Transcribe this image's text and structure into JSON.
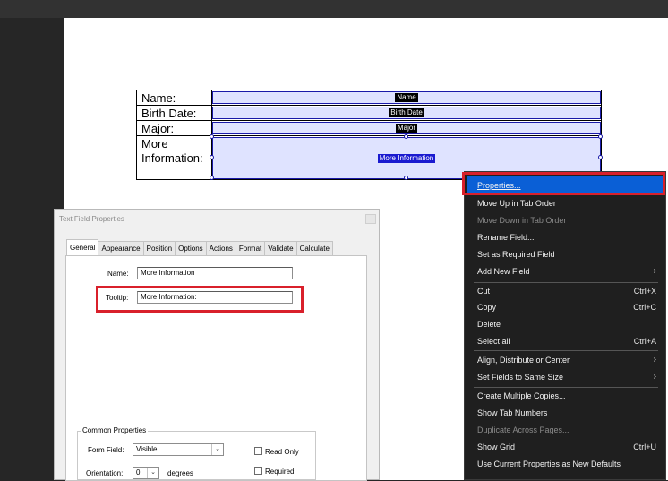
{
  "form": {
    "rows": [
      {
        "label": "Name:",
        "field": "Name"
      },
      {
        "label": "Birth Date:",
        "field": "Birth Date"
      },
      {
        "label": "Major:",
        "field": "Major"
      },
      {
        "label_line1": "More",
        "label_line2": "Information:",
        "field": "More Information"
      }
    ]
  },
  "dialog": {
    "title": "Text Field Properties",
    "tabs": [
      "General",
      "Appearance",
      "Position",
      "Options",
      "Actions",
      "Format",
      "Validate",
      "Calculate"
    ],
    "name_label": "Name:",
    "name_value": "More Information",
    "tooltip_label": "Tooltip:",
    "tooltip_value": "More Information:",
    "common_title": "Common Properties",
    "form_field_label": "Form Field:",
    "form_field_value": "Visible",
    "read_only_label": "Read Only",
    "orientation_label": "Orientation:",
    "orientation_value": "0",
    "degrees_label": "degrees",
    "required_label": "Required"
  },
  "menu": {
    "items": [
      {
        "label": "Properties..."
      },
      {
        "label": "Move Up in Tab Order"
      },
      {
        "label": "Move Down in Tab Order",
        "disabled": true
      },
      {
        "label": "Rename Field..."
      },
      {
        "label": "Set as Required Field"
      },
      {
        "label": "Add New Field",
        "submenu": true
      },
      {
        "label": "Cut",
        "shortcut": "Ctrl+X"
      },
      {
        "label": "Copy",
        "shortcut": "Ctrl+C"
      },
      {
        "label": "Delete"
      },
      {
        "label": "Select all",
        "shortcut": "Ctrl+A"
      },
      {
        "label": "Align, Distribute or Center",
        "submenu": true
      },
      {
        "label": "Set Fields to Same Size",
        "submenu": true
      },
      {
        "label": "Create Multiple Copies..."
      },
      {
        "label": "Show Tab Numbers"
      },
      {
        "label": "Duplicate Across Pages...",
        "disabled": true
      },
      {
        "label": "Show Grid",
        "shortcut": "Ctrl+U"
      },
      {
        "label": "Use Current Properties as New Defaults"
      }
    ]
  }
}
